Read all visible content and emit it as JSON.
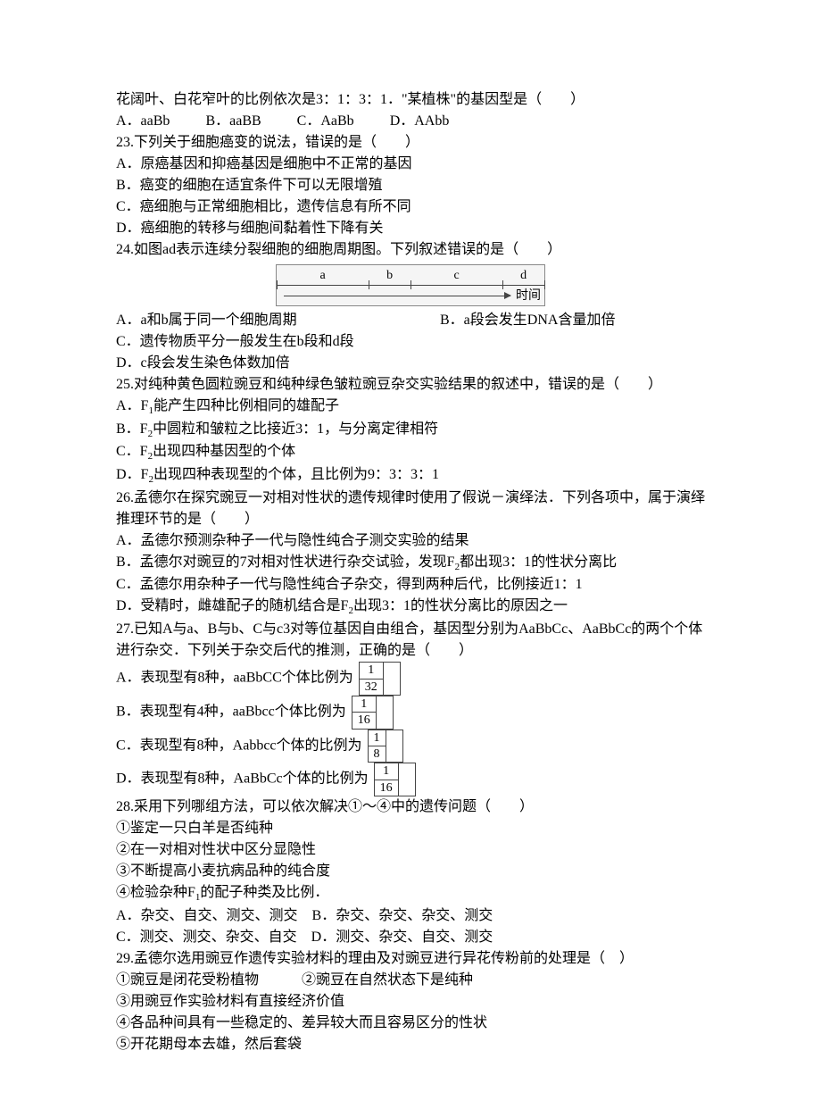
{
  "q22_tail": {
    "line": "花阔叶、白花窄叶的比例依次是3：1：3：1．\"某植株\"的基因型是（　　）",
    "opts": {
      "a": "A．aaBb",
      "b": "B．aaBB",
      "c": "C．AaBb",
      "d": "D．AAbb"
    }
  },
  "q23": {
    "stem": "23.下列关于细胞癌变的说法，错误的是（　　）",
    "a": "A．原癌基因和抑癌基因是细胞中不正常的基因",
    "b": "B．癌变的细胞在适宜条件下可以无限增殖",
    "c": "C．癌细胞与正常细胞相比，遗传信息有所不同",
    "d": "D．癌细胞的转移与细胞间黏着性下降有关"
  },
  "q24": {
    "stem": "24.如图ad表示连续分裂细胞的细胞周期图。下列叙述错误的是（　　）",
    "diagram": {
      "seg_a": "a",
      "seg_b": "b",
      "seg_c": "c",
      "seg_d": "d",
      "time": "时间"
    },
    "a": "A．a和b属于同一个细胞周期",
    "b": "B．a段会发生DNA含量加倍",
    "c": "C．遗传物质平分一般发生在b段和d段",
    "d": "D．c段会发生染色体数加倍"
  },
  "q25": {
    "stem": "25.对纯种黄色圆粒豌豆和纯种绿色皱粒豌豆杂交实验结果的叙述中，错误的是（　　）",
    "a_pre": "A．F",
    "a_sub": "1",
    "a_post": "能产生四种比例相同的雄配子",
    "b_pre": "B．F",
    "b_sub": "2",
    "b_post": "中圆粒和皱粒之比接近3：1，与分离定律相符",
    "c_pre": "C．F",
    "c_sub": "2",
    "c_post": "出现四种基因型的个体",
    "d_pre": "D．F",
    "d_sub": "2",
    "d_post": "出现四种表现型的个体，且比例为9：3：3：1"
  },
  "q26": {
    "stem": "26.孟德尔在探究豌豆一对相对性状的遗传规律时使用了假说－演绎法．下列各项中，属于演绎推理环节的是（　　）",
    "a": "A．孟德尔预测杂种子一代与隐性纯合子测交实验的结果",
    "b_pre": "B．孟德尔对豌豆的7对相对性状进行杂交试验，发现F",
    "b_sub": "2",
    "b_post": "都出现3：1的性状分离比",
    "c": "C．孟德尔用杂种子一代与隐性纯合子杂交，得到两种后代，比例接近1：1",
    "d_pre": "D．受精时，雌雄配子的随机结合是F",
    "d_sub": "2",
    "d_post": "出现3：1的性状分离比的原因之一"
  },
  "q27": {
    "stem": "27.已知A与a、B与b、C与c3对等位基因自由组合，基因型分别为AaBbCc、AaBbCc的两个个体进行杂交．下列关于杂交后代的推测，正确的是（　　）",
    "a_text": "A．表现型有8种，aaBbCC个体比例为",
    "a_num": "1",
    "a_den": "32",
    "b_text": "B．表现型有4种，aaBbcc个体比例为",
    "b_num": "1",
    "b_den": "16",
    "c_text": "C．表现型有8种，Aabbcc个体的比例为",
    "c_num": "1",
    "c_den": "8",
    "d_text": "D．表现型有8种，AaBbCc个体的比例为",
    "d_num": "1",
    "d_den": "16"
  },
  "q28": {
    "stem": "28.采用下列哪组方法，可以依次解决①～④中的遗传问题（　　）",
    "l1": "①鉴定一只白羊是否纯种",
    "l2": "②在一对相对性状中区分显隐性",
    "l3": "③不断提高小麦抗病品种的纯合度",
    "l4_pre": "④检验杂种F",
    "l4_sub": "1",
    "l4_post": "的配子种类及比例．",
    "row1": "A．杂交、自交、测交、测交　B．杂交、杂交、杂交、测交",
    "row2": "C．测交、测交、杂交、自交　D．测交、杂交、自交、测交"
  },
  "q29": {
    "stem": "29.孟德尔选用豌豆作遗传实验材料的理由及对豌豆进行异花传粉前的处理是（　）",
    "l1": "①豌豆是闭花受粉植物　　　②豌豆在自然状态下是纯种",
    "l2": "③用豌豆作实验材料有直接经济价值",
    "l3": "④各品种间具有一些稳定的、差异较大而且容易区分的性状",
    "l4": "⑤开花期母本去雄，然后套袋"
  }
}
